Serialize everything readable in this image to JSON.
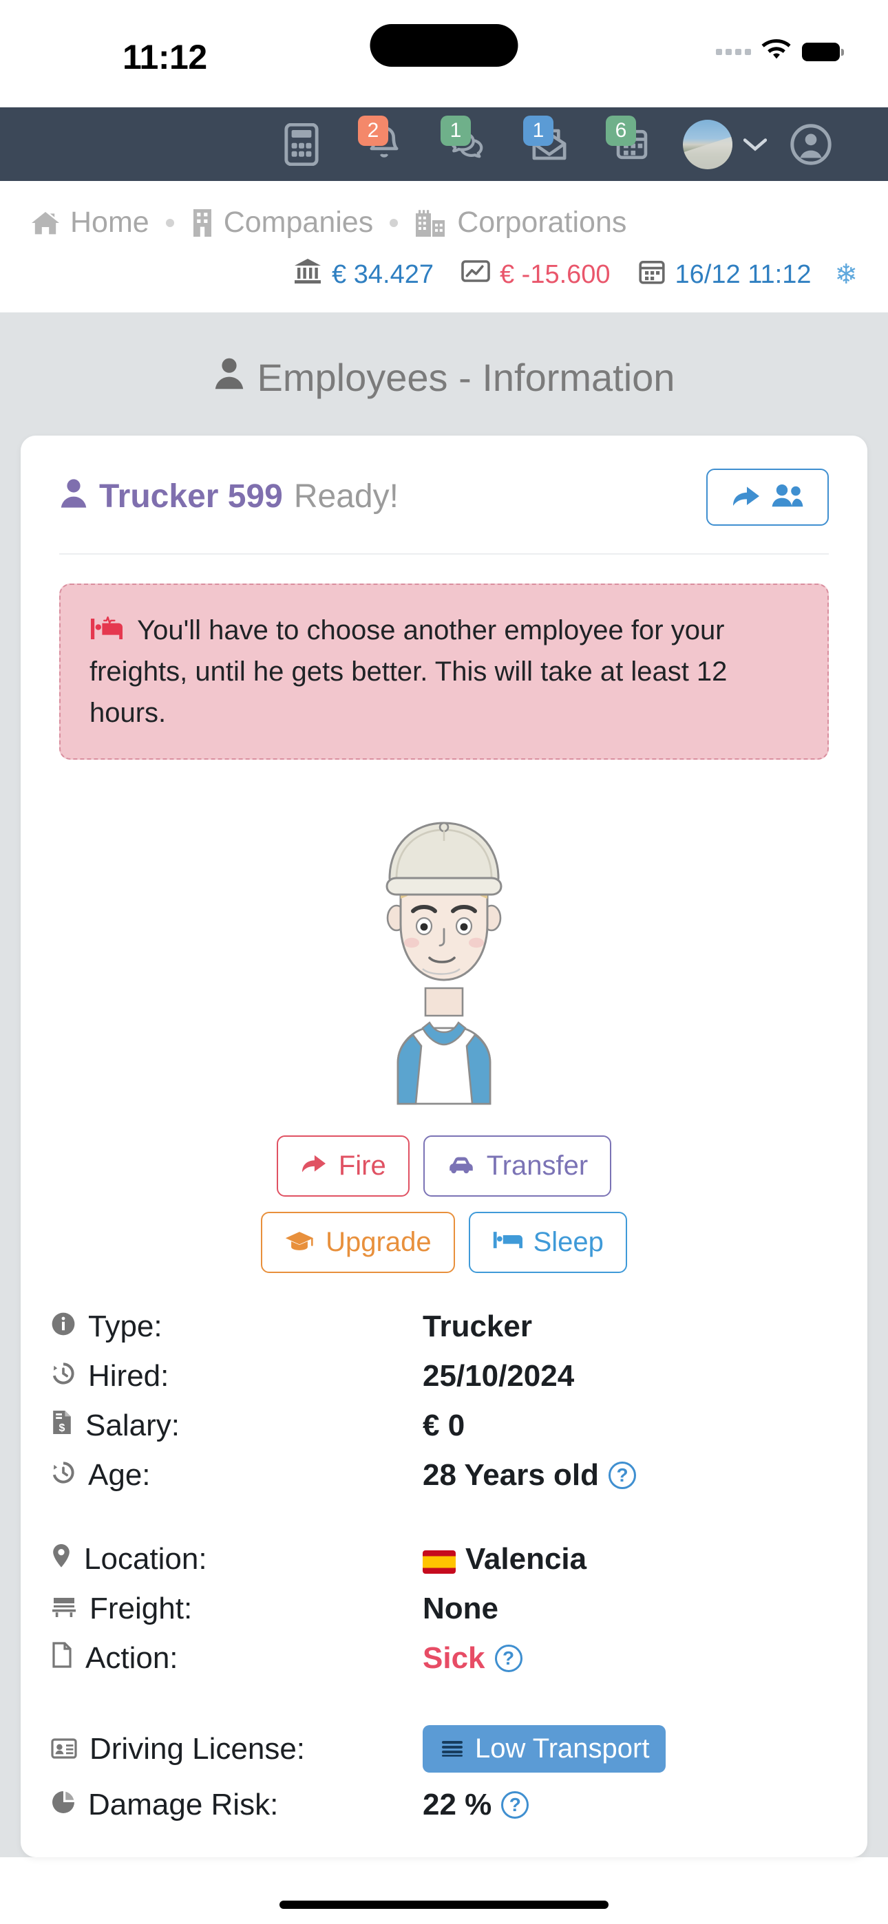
{
  "status_bar": {
    "time": "11:12",
    "signal_icon": "signal-dots-icon",
    "wifi_icon": "wifi-icon",
    "battery_icon": "battery-icon"
  },
  "navbar": {
    "items": [
      {
        "icon": "calculator-icon",
        "badge": null,
        "badge_color": null
      },
      {
        "icon": "bell-icon",
        "badge": "2",
        "badge_color": "#f4886a"
      },
      {
        "icon": "chat-icon",
        "badge": "1",
        "badge_color": "#6fb08a"
      },
      {
        "icon": "envelope-icon",
        "badge": "1",
        "badge_color": "#5b9bd5"
      },
      {
        "icon": "calendar-icon",
        "badge": "6",
        "badge_color": "#6fb08a"
      }
    ],
    "profile_avatar": "profile-avatar",
    "caret": "chevron-down-icon",
    "account_icon": "user-circle-icon",
    "background": "#3c4858"
  },
  "breadcrumb": {
    "items": [
      {
        "icon": "home-icon",
        "label": "Home"
      },
      {
        "icon": "building-icon",
        "label": "Companies"
      },
      {
        "icon": "city-icon",
        "label": "Corporations"
      }
    ]
  },
  "stats": {
    "bank": {
      "icon": "bank-icon",
      "value": "€ 34.427",
      "color": "#2f7fc1"
    },
    "chart": {
      "icon": "chart-line-icon",
      "value": "€ -15.600",
      "color": "#e9566b"
    },
    "calendar": {
      "icon": "calendar-icon",
      "value": "16/12 11:12",
      "color": "#2f7fc1"
    },
    "weather": {
      "icon": "snowflake-icon",
      "glyph": "❄",
      "color": "#5fa8dd"
    }
  },
  "page": {
    "title": "Employees - Information",
    "title_icon": "person-icon"
  },
  "employee": {
    "name": "Trucker 599",
    "state": "Ready!",
    "name_icon": "person-icon",
    "share_button": {
      "icon_left": "share-arrow-icon",
      "icon_right": "people-icon"
    },
    "alert": {
      "icon": "hospital-bed-icon",
      "text": "You'll have to choose another employee for your freights, until he gets better. This will take at least 12 hours."
    },
    "avatar": "trucker-avatar-illustration",
    "buttons": [
      {
        "label": "Fire",
        "icon": "share-arrow-icon",
        "color": "#e05263"
      },
      {
        "label": "Transfer",
        "icon": "car-icon",
        "color": "#7b73b5"
      },
      {
        "label": "Upgrade",
        "icon": "graduation-cap-icon",
        "color": "#e8903c"
      },
      {
        "label": "Sleep",
        "icon": "bed-icon",
        "color": "#3f9ad8"
      }
    ],
    "details_group_1": [
      {
        "icon": "info-icon",
        "label": "Type:",
        "value": "Trucker"
      },
      {
        "icon": "history-icon",
        "label": "Hired:",
        "value": "25/10/2024"
      },
      {
        "icon": "payroll-icon",
        "label": "Salary:",
        "value": "€ 0"
      },
      {
        "icon": "history-icon",
        "label": "Age:",
        "value": "28 Years old",
        "help": "?"
      }
    ],
    "details_group_2": [
      {
        "icon": "map-pin-icon",
        "label": "Location:",
        "value": "Valencia",
        "flag": "spain-flag"
      },
      {
        "icon": "freight-icon",
        "label": "Freight:",
        "value": "None"
      },
      {
        "icon": "document-icon",
        "label": "Action:",
        "value": "Sick",
        "value_color": "#e74c65",
        "help": "?"
      }
    ],
    "details_group_3": [
      {
        "icon": "id-card-icon",
        "label": "Driving License:",
        "value": "Low Transport",
        "pill": true,
        "pill_icon": "license-stack-icon",
        "pill_color": "#5b9bd5"
      },
      {
        "icon": "pie-chart-icon",
        "label": "Damage Risk:",
        "value": "22 %",
        "help": "?"
      }
    ]
  }
}
